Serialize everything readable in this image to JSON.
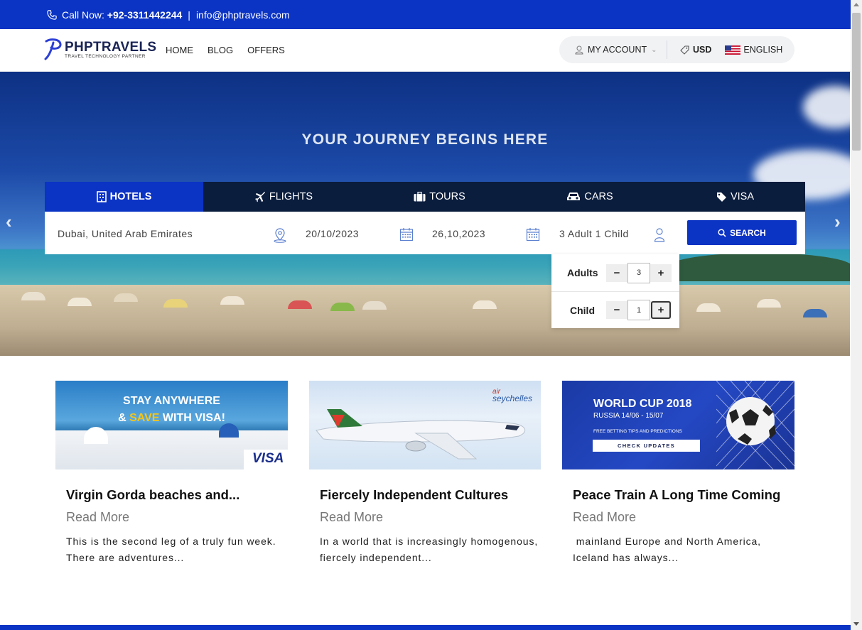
{
  "topbar": {
    "call_label": "Call Now:",
    "phone": "+92-3311442244",
    "separator": "|",
    "email": "info@phptravels.com"
  },
  "header": {
    "logo_name": "PHPTRAVELS",
    "logo_tagline": "TRAVEL TECHNOLOGY PARTNER",
    "nav": [
      "HOME",
      "BLOG",
      "OFFERS"
    ],
    "account_label": "MY ACCOUNT",
    "currency": "USD",
    "language": "ENGLISH"
  },
  "hero": {
    "title": "YOUR JOURNEY BEGINS HERE",
    "prev_arrow": "‹",
    "next_arrow": "›"
  },
  "tabs": [
    {
      "label": "HOTELS",
      "icon": "building-icon",
      "active": true
    },
    {
      "label": "FLIGHTS",
      "icon": "plane-icon",
      "active": false
    },
    {
      "label": "TOURS",
      "icon": "suitcase-icon",
      "active": false
    },
    {
      "label": "CARS",
      "icon": "car-icon",
      "active": false
    },
    {
      "label": "VISA",
      "icon": "tag-icon",
      "active": false
    }
  ],
  "search": {
    "destination": "Dubai, United Arab Emirates",
    "checkin": "20/10/2023",
    "checkout": "26,10,2023",
    "guests": "3 Adult 1 Child",
    "button": "SEARCH"
  },
  "guests_dropdown": {
    "adults_label": "Adults",
    "adults_value": "3",
    "child_label": "Child",
    "child_value": "1",
    "minus": "−",
    "plus": "+"
  },
  "cards": [
    {
      "image_text_line1": "STAY ANYWHERE",
      "image_text_amp": "&",
      "image_text_save": "SAVE",
      "image_text_rest": "WITH VISA!",
      "image_brand": "VISA",
      "title": "Virgin Gorda beaches and...",
      "read_more": "Read More",
      "desc": "This is the second leg of a truly fun week. There are adventures..."
    },
    {
      "image_brand_small": "air",
      "image_brand": "seychelles",
      "title": "Fiercely Independent Cultures",
      "read_more": "Read More",
      "desc": "In a world that is increasingly homogenous, fiercely independent..."
    },
    {
      "image_title": "WORLD CUP 2018",
      "image_sub": "RUSSIA 14/06 - 15/07",
      "image_small": "FREE BETTING TIPS AND PREDICTIONS",
      "image_button": "CHECK UPDATES",
      "title": "Peace Train A Long Time Coming",
      "read_more": "Read More",
      "desc": " mainland Europe and North America, Iceland has always..."
    }
  ],
  "colors": {
    "brand_blue": "#0b33c4",
    "tab_bar": "#0b1d3d"
  }
}
